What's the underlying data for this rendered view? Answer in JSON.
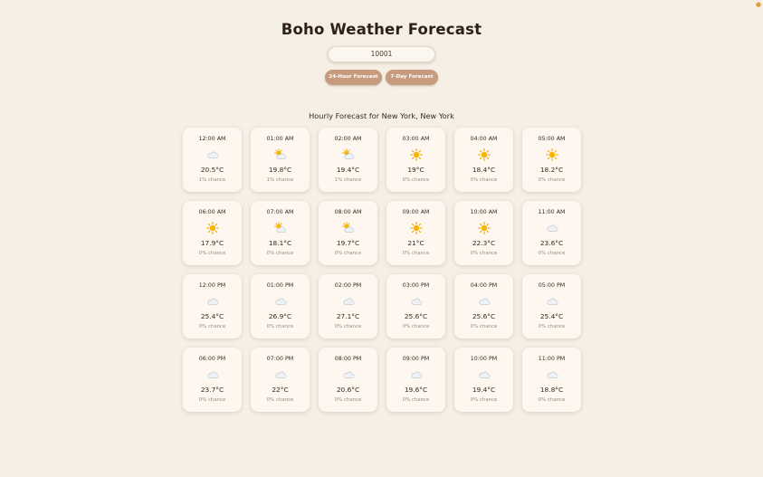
{
  "header": {
    "title": "Boho Weather Forecast"
  },
  "search": {
    "zip_value": "10001"
  },
  "buttons": {
    "hourly_label": "24-Hour Forecast",
    "weekly_label": "7-Day Forecast"
  },
  "forecast": {
    "heading": "Hourly Forecast for New York, New York",
    "hours": [
      {
        "time": "12:00 AM",
        "icon": "cloud-icon",
        "temp": "20.5°C",
        "chance": "1% chance"
      },
      {
        "time": "01:00 AM",
        "icon": "partly-cloudy-icon",
        "temp": "19.8°C",
        "chance": "1% chance"
      },
      {
        "time": "02:00 AM",
        "icon": "partly-cloudy-icon",
        "temp": "19.4°C",
        "chance": "1% chance"
      },
      {
        "time": "03:00 AM",
        "icon": "sun-icon",
        "temp": "19°C",
        "chance": "0% chance"
      },
      {
        "time": "04:00 AM",
        "icon": "sun-icon",
        "temp": "18.4°C",
        "chance": "0% chance"
      },
      {
        "time": "05:00 AM",
        "icon": "sun-icon",
        "temp": "18.2°C",
        "chance": "0% chance"
      },
      {
        "time": "06:00 AM",
        "icon": "sun-icon",
        "temp": "17.9°C",
        "chance": "0% chance"
      },
      {
        "time": "07:00 AM",
        "icon": "partly-cloudy-icon",
        "temp": "18.1°C",
        "chance": "0% chance"
      },
      {
        "time": "08:00 AM",
        "icon": "partly-cloudy-icon",
        "temp": "19.7°C",
        "chance": "0% chance"
      },
      {
        "time": "09:00 AM",
        "icon": "sun-icon",
        "temp": "21°C",
        "chance": "0% chance"
      },
      {
        "time": "10:00 AM",
        "icon": "sun-icon",
        "temp": "22.3°C",
        "chance": "0% chance"
      },
      {
        "time": "11:00 AM",
        "icon": "cloud-icon",
        "temp": "23.6°C",
        "chance": "0% chance"
      },
      {
        "time": "12:00 PM",
        "icon": "cloud-icon",
        "temp": "25.4°C",
        "chance": "0% chance"
      },
      {
        "time": "01:00 PM",
        "icon": "cloud-icon",
        "temp": "26.9°C",
        "chance": "0% chance"
      },
      {
        "time": "02:00 PM",
        "icon": "cloud-icon",
        "temp": "27.1°C",
        "chance": "0% chance"
      },
      {
        "time": "03:00 PM",
        "icon": "cloud-icon",
        "temp": "25.6°C",
        "chance": "0% chance"
      },
      {
        "time": "04:00 PM",
        "icon": "cloud-icon",
        "temp": "25.6°C",
        "chance": "0% chance"
      },
      {
        "time": "05:00 PM",
        "icon": "cloud-icon",
        "temp": "25.4°C",
        "chance": "0% chance"
      },
      {
        "time": "06:00 PM",
        "icon": "cloud-icon",
        "temp": "23.7°C",
        "chance": "0% chance"
      },
      {
        "time": "07:00 PM",
        "icon": "cloud-icon",
        "temp": "22°C",
        "chance": "0% chance"
      },
      {
        "time": "08:00 PM",
        "icon": "cloud-icon",
        "temp": "20.6°C",
        "chance": "0% chance"
      },
      {
        "time": "09:00 PM",
        "icon": "cloud-icon",
        "temp": "19.6°C",
        "chance": "0% chance"
      },
      {
        "time": "10:00 PM",
        "icon": "cloud-icon",
        "temp": "19.4°C",
        "chance": "0% chance"
      },
      {
        "time": "11:00 PM",
        "icon": "cloud-icon",
        "temp": "18.8°C",
        "chance": "0% chance"
      }
    ]
  },
  "colors": {
    "background": "#f6efe6",
    "card": "#fdf7f0",
    "button": "#c79b7e",
    "sun": "#f5b400",
    "cloud": "#e6ecf2"
  }
}
